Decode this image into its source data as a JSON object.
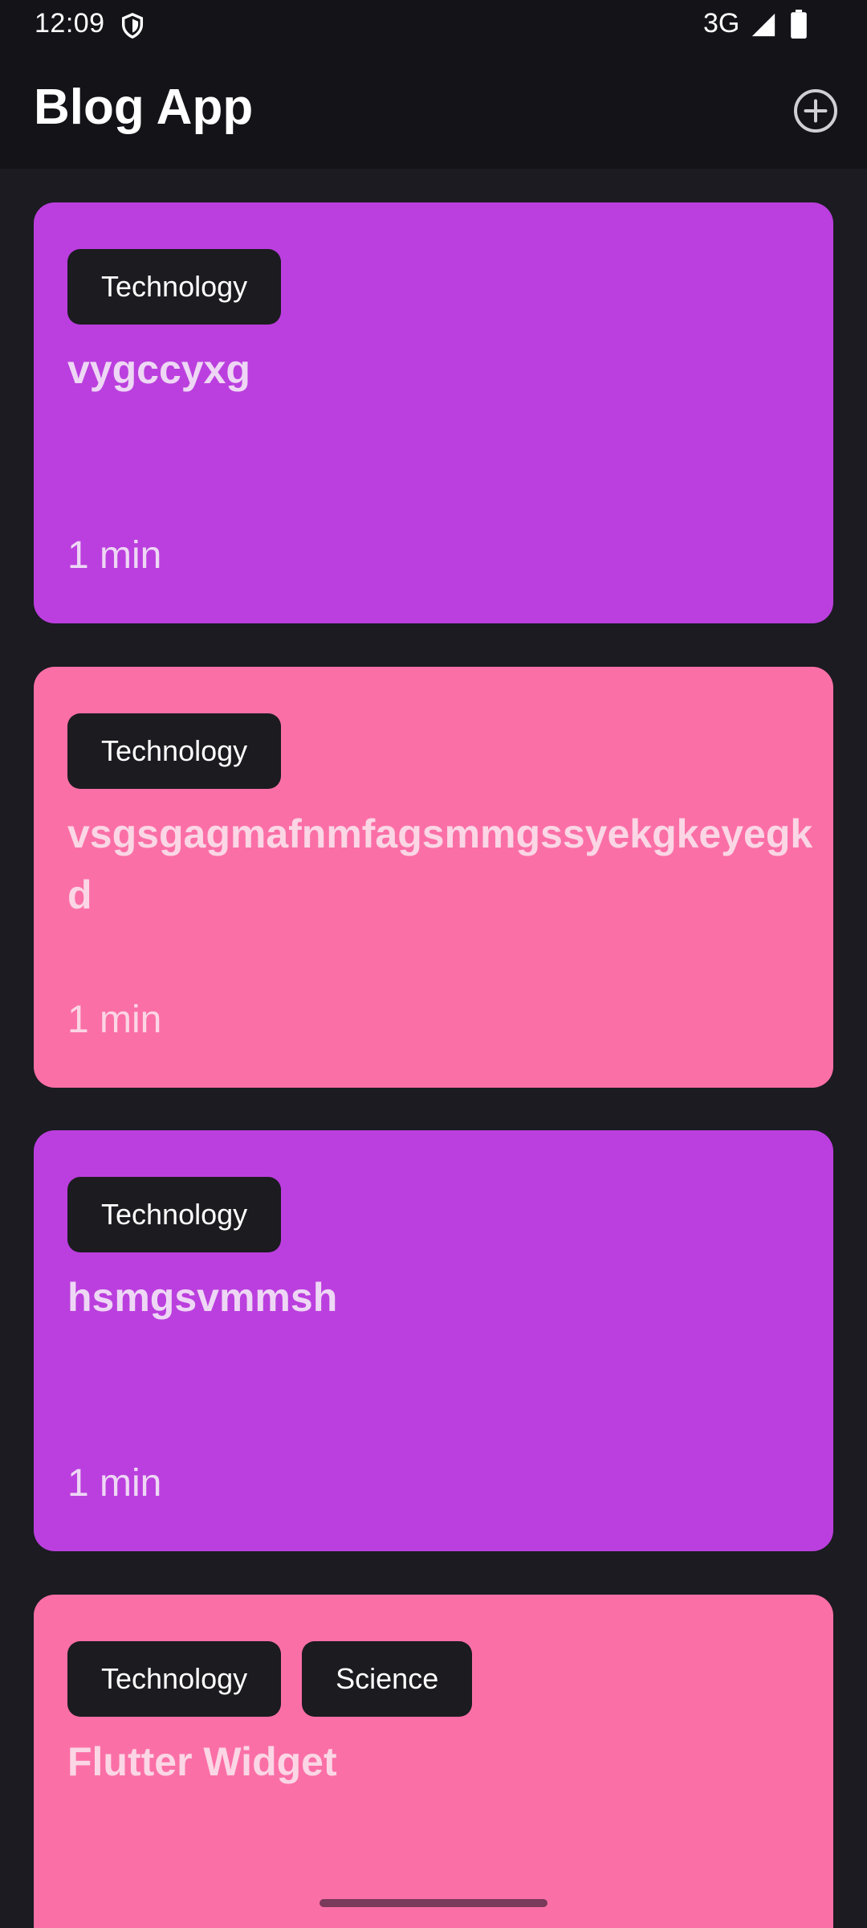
{
  "status_bar": {
    "time": "12:09",
    "network": "3G",
    "shield_icon": "shield-icon",
    "signal_icon": "cell-signal-icon",
    "battery_icon": "battery-full-icon"
  },
  "app_bar": {
    "title": "Blog App",
    "add_icon": "add-circle-icon"
  },
  "colors": {
    "background": "#1b1b21",
    "app_bar": "#141318",
    "card_purple": "#bb3fde",
    "card_pink": "#fb6fa7",
    "tag_background": "#1b1b20"
  },
  "posts": [
    {
      "tags": [
        "Technology"
      ],
      "title": "vygccyxg",
      "read_time": "1 min",
      "color": "#bb3fde"
    },
    {
      "tags": [
        "Technology"
      ],
      "title": "vsgsgagmafnmfagsmmgssyekgkeyegkd",
      "read_time": "1 min",
      "color": "#fb6fa7"
    },
    {
      "tags": [
        "Technology"
      ],
      "title": "hsmgsvmmsh",
      "read_time": "1 min",
      "color": "#bb3fde"
    },
    {
      "tags": [
        "Technology",
        "Science"
      ],
      "title": "Flutter Widget",
      "read_time": "",
      "color": "#fb6fa7"
    }
  ]
}
